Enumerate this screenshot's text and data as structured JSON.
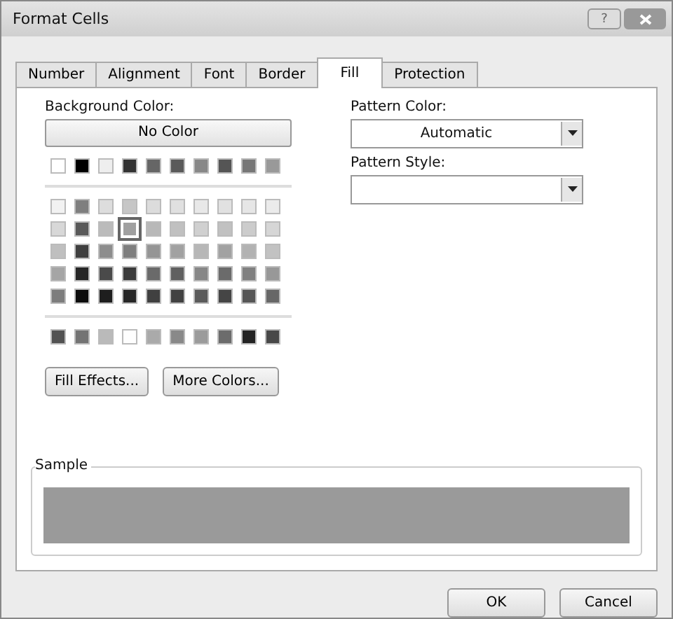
{
  "window": {
    "title": "Format Cells",
    "help": "?"
  },
  "tabs": [
    {
      "label": "Number",
      "selected": false
    },
    {
      "label": "Alignment",
      "selected": false
    },
    {
      "label": "Font",
      "selected": false
    },
    {
      "label": "Border",
      "selected": false
    },
    {
      "label": "Fill",
      "selected": true
    },
    {
      "label": "Protection",
      "selected": false
    }
  ],
  "background_color": {
    "label": "Background Color:",
    "no_color_button": "No Color",
    "palettes": [
      [
        {
          "color": "#ffffff",
          "selected": false
        },
        {
          "color": "#000000",
          "selected": false
        },
        {
          "color": "#eeeeee",
          "selected": false
        },
        {
          "color": "#333333",
          "selected": false
        },
        {
          "color": "#666666",
          "selected": false
        },
        {
          "color": "#5a5a5a",
          "selected": false
        },
        {
          "color": "#888888",
          "selected": false
        },
        {
          "color": "#555555",
          "selected": false
        },
        {
          "color": "#777777",
          "selected": false
        },
        {
          "color": "#999999",
          "selected": false
        }
      ],
      [
        {
          "color": "#f2f2f2",
          "selected": false
        },
        {
          "color": "#7f7f7f",
          "selected": false
        },
        {
          "color": "#dddddd",
          "selected": false
        },
        {
          "color": "#c6c6c6",
          "selected": false
        },
        {
          "color": "#dcdcdc",
          "selected": false
        },
        {
          "color": "#e0e0e0",
          "selected": false
        },
        {
          "color": "#e8e8e8",
          "selected": false
        },
        {
          "color": "#e1e1e1",
          "selected": false
        },
        {
          "color": "#e6e6e6",
          "selected": false
        },
        {
          "color": "#ebebeb",
          "selected": false
        },
        {
          "color": "#d8d8d8",
          "selected": false
        },
        {
          "color": "#595959",
          "selected": false
        },
        {
          "color": "#bbbbbb",
          "selected": false
        },
        {
          "color": "#a0a0a0",
          "selected": true
        },
        {
          "color": "#b8b8b8",
          "selected": false
        },
        {
          "color": "#c0c0c0",
          "selected": false
        },
        {
          "color": "#d0d0d0",
          "selected": false
        },
        {
          "color": "#c1c1c1",
          "selected": false
        },
        {
          "color": "#cccccc",
          "selected": false
        },
        {
          "color": "#d6d6d6",
          "selected": false
        },
        {
          "color": "#bfbfbf",
          "selected": false
        },
        {
          "color": "#3f3f3f",
          "selected": false
        },
        {
          "color": "#8d8d8d",
          "selected": false
        },
        {
          "color": "#7e7e7e",
          "selected": false
        },
        {
          "color": "#959595",
          "selected": false
        },
        {
          "color": "#a1a1a1",
          "selected": false
        },
        {
          "color": "#b7b7b7",
          "selected": false
        },
        {
          "color": "#a2a2a2",
          "selected": false
        },
        {
          "color": "#b2b2b2",
          "selected": false
        },
        {
          "color": "#c2c2c2",
          "selected": false
        },
        {
          "color": "#a5a5a5",
          "selected": false
        },
        {
          "color": "#262626",
          "selected": false
        },
        {
          "color": "#4a4a4a",
          "selected": false
        },
        {
          "color": "#3a3a3a",
          "selected": false
        },
        {
          "color": "#6a6a6a",
          "selected": false
        },
        {
          "color": "#606060",
          "selected": false
        },
        {
          "color": "#878787",
          "selected": false
        },
        {
          "color": "#6b6b6b",
          "selected": false
        },
        {
          "color": "#808080",
          "selected": false
        },
        {
          "color": "#989898",
          "selected": false
        },
        {
          "color": "#7d7d7d",
          "selected": false
        },
        {
          "color": "#0c0c0c",
          "selected": false
        },
        {
          "color": "#1e1e1e",
          "selected": false
        },
        {
          "color": "#272727",
          "selected": false
        },
        {
          "color": "#404040",
          "selected": false
        },
        {
          "color": "#414141",
          "selected": false
        },
        {
          "color": "#5b5b5b",
          "selected": false
        },
        {
          "color": "#454545",
          "selected": false
        },
        {
          "color": "#565656",
          "selected": false
        },
        {
          "color": "#676767",
          "selected": false
        }
      ],
      [
        {
          "color": "#525252",
          "selected": false
        },
        {
          "color": "#747474",
          "selected": false
        },
        {
          "color": "#bababa",
          "selected": false
        },
        {
          "color": "#fefefe",
          "selected": false
        },
        {
          "color": "#aaaaaa",
          "selected": false
        },
        {
          "color": "#898989",
          "selected": false
        },
        {
          "color": "#9b9b9b",
          "selected": false
        },
        {
          "color": "#6c6c6c",
          "selected": false
        },
        {
          "color": "#232323",
          "selected": false
        },
        {
          "color": "#484848",
          "selected": false
        }
      ]
    ],
    "buttons": [
      "Fill Effects...",
      "More Colors..."
    ]
  },
  "pattern_color": {
    "label": "Pattern Color:",
    "value": "Automatic"
  },
  "pattern_style": {
    "label": "Pattern Style:"
  },
  "sample": {
    "label": "Sample",
    "color": "#9a9a9a"
  },
  "buttons": [
    "OK",
    "Cancel"
  ]
}
